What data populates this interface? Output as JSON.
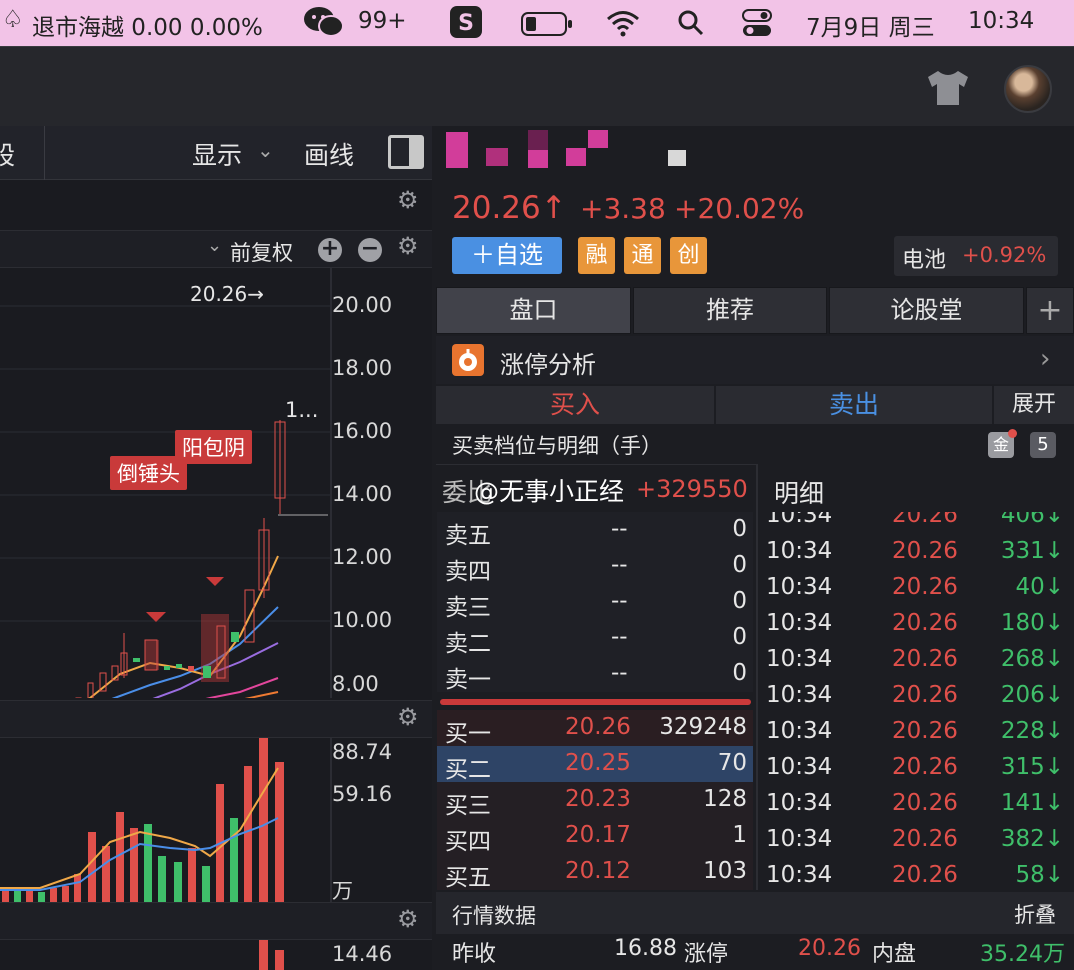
{
  "menubar": {
    "stock_alert": "退市海越 0.00 0.00%",
    "wechat_count": "99+",
    "date": "7月9日 周三",
    "time": "10:34"
  },
  "chart_toolbar": {
    "left_label": "股",
    "display_label": "显示",
    "draw_label": "画线",
    "adjust_label": "前复权"
  },
  "price_chart": {
    "high_label": "20.26→",
    "truncated_label": "1...",
    "pattern_labels": [
      "倒锤头",
      "阳包阴"
    ],
    "y_ticks": [
      "20.00",
      "18.00",
      "16.00",
      "14.00",
      "12.00",
      "10.00",
      "8.00"
    ]
  },
  "volume_chart": {
    "y_ticks": [
      "88.74",
      "59.16",
      "万"
    ]
  },
  "third_chart": {
    "y_tick": "14.46"
  },
  "quote": {
    "price": "20.26↑",
    "change": "+3.38",
    "change_pct": "+20.02%",
    "add_watch": "＋自选",
    "tags": [
      "融",
      "通",
      "创"
    ],
    "sector_name": "电池",
    "sector_change": "+0.92%"
  },
  "tabs": [
    "盘口",
    "推荐",
    "论股堂",
    "+"
  ],
  "limit_up_analysis": "涨停分析",
  "trade_buttons": {
    "buy": "买入",
    "sell": "卖出",
    "expand": "展开"
  },
  "orderbook": {
    "title": "买卖档位与明细（手）",
    "badge": "5",
    "ratio_label": "委比",
    "ratio_value": "+329550",
    "watermark": "@无事小正经",
    "asks": [
      {
        "label": "卖五",
        "price": "--",
        "volume": "0"
      },
      {
        "label": "卖四",
        "price": "--",
        "volume": "0"
      },
      {
        "label": "卖三",
        "price": "--",
        "volume": "0"
      },
      {
        "label": "卖二",
        "price": "--",
        "volume": "0"
      },
      {
        "label": "卖一",
        "price": "--",
        "volume": "0"
      }
    ],
    "bids": [
      {
        "label": "买一",
        "price": "20.26",
        "volume": "329248"
      },
      {
        "label": "买二",
        "price": "20.25",
        "volume": "70"
      },
      {
        "label": "买三",
        "price": "20.23",
        "volume": "128"
      },
      {
        "label": "买四",
        "price": "20.17",
        "volume": "1"
      },
      {
        "label": "买五",
        "price": "20.12",
        "volume": "103"
      }
    ]
  },
  "details": {
    "title": "明细",
    "rows": [
      {
        "time": "10:34",
        "price": "20.26",
        "volume": "406↓"
      },
      {
        "time": "10:34",
        "price": "20.26",
        "volume": "331↓"
      },
      {
        "time": "10:34",
        "price": "20.26",
        "volume": "40↓"
      },
      {
        "time": "10:34",
        "price": "20.26",
        "volume": "180↓"
      },
      {
        "time": "10:34",
        "price": "20.26",
        "volume": "268↓"
      },
      {
        "time": "10:34",
        "price": "20.26",
        "volume": "206↓"
      },
      {
        "time": "10:34",
        "price": "20.26",
        "volume": "228↓"
      },
      {
        "time": "10:34",
        "price": "20.26",
        "volume": "315↓"
      },
      {
        "time": "10:34",
        "price": "20.26",
        "volume": "141↓"
      },
      {
        "time": "10:34",
        "price": "20.26",
        "volume": "382↓"
      },
      {
        "time": "10:34",
        "price": "20.26",
        "volume": "58↓"
      }
    ]
  },
  "market_data": {
    "title": "行情数据",
    "collapse": "折叠",
    "prev_close_label": "昨收",
    "prev_close": "16.88",
    "limit_up_label": "涨停",
    "limit_up": "20.26",
    "inner_label": "内盘",
    "inner": "35.24万"
  },
  "colors": {
    "up": "#e0504b",
    "down": "#3fbf6a",
    "accent": "#4a90e2",
    "menubar": "#f2c3e7"
  }
}
